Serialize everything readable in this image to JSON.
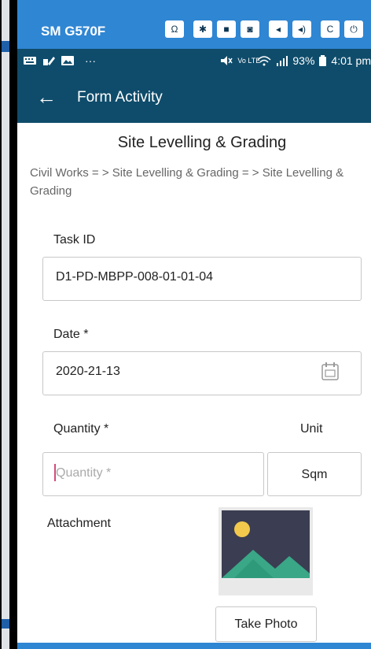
{
  "device": {
    "name": "SM G570F",
    "controls": [
      {
        "icon": "headset-icon",
        "glyph": "Ω"
      },
      {
        "icon": "settings-icon",
        "glyph": "✱"
      },
      {
        "icon": "video-icon",
        "glyph": "■"
      },
      {
        "icon": "camera-icon",
        "glyph": "◙"
      },
      {
        "icon": "volume-down-icon",
        "glyph": "◂"
      },
      {
        "icon": "volume-up-icon",
        "glyph": "◂)"
      },
      {
        "icon": "rotate-icon",
        "glyph": "C"
      },
      {
        "icon": "power-icon",
        "glyph": "⏻"
      }
    ]
  },
  "status_bar": {
    "left_icons": [
      "keyboard-icon",
      "edit-icon",
      "image-icon"
    ],
    "more": "···",
    "network": "Vo LTE",
    "battery": "93%",
    "time": "4:01 pm"
  },
  "app_bar": {
    "title": "Form Activity"
  },
  "page": {
    "title": "Site Levelling & Grading",
    "breadcrumb": "Civil Works = > Site Levelling & Grading = > Site Levelling & Grading"
  },
  "form": {
    "task_id_label": "Task ID",
    "task_id_value": "D1-PD-MBPP-008-01-01-04",
    "date_label": "Date *",
    "date_value": "2020-21-13",
    "quantity_label": "Quantity *",
    "quantity_placeholder": "Quantity *",
    "unit_label": "Unit",
    "unit_value": "Sqm",
    "attachment_label": "Attachment",
    "take_photo_label": "Take Photo"
  },
  "colors": {
    "device_bar": "#2f86d3",
    "app_bar": "#0f4c6b",
    "caret": "#d14b7a"
  }
}
